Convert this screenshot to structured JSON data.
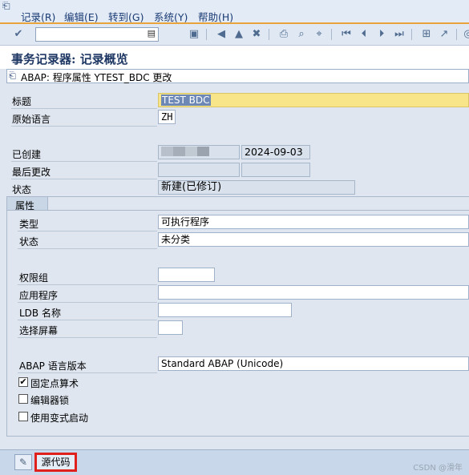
{
  "menubar": {
    "items": [
      "记录(R)",
      "编辑(E)",
      "转到(G)",
      "系统(Y)",
      "帮助(H)"
    ]
  },
  "toolbar": {
    "command_value": "",
    "icons": [
      "check-icon",
      "save-icon",
      "back-icon",
      "exit-icon",
      "cancel-icon",
      "print-icon",
      "find-icon",
      "find-next-icon",
      "first-page-icon",
      "prev-page-icon",
      "next-page-icon",
      "last-page-icon",
      "layout-icon",
      "help-icon"
    ]
  },
  "page": {
    "title": "事务记录器: 记录概览",
    "subheading": "ABAP: 程序属性 YTEST_BDC 更改"
  },
  "form": {
    "title_label": "标题",
    "title_value": "TEST BDC",
    "lang_label": "原始语言",
    "lang_value": "ZH",
    "created_label": "已创建",
    "created_date": "2024-09-03",
    "changed_label": "最后更改",
    "status_label": "状态",
    "status_value": "新建(已修订)"
  },
  "attributes": {
    "tab_label": "属性",
    "type_label": "类型",
    "type_value": "可执行程序",
    "status_label": "状态",
    "status_value": "未分类",
    "auth_group_label": "权限组",
    "application_label": "应用程序",
    "ldb_label": "LDB 名称",
    "screen_label": "选择屏幕",
    "abap_version_label": "ABAP 语言版本",
    "abap_version_value": "Standard ABAP (Unicode)",
    "fixed_point_label": "固定点算术",
    "fixed_point_checked": true,
    "editor_lock_label": "编辑器锁",
    "editor_lock_checked": false,
    "variant_start_label": "使用变式启动",
    "variant_start_checked": false
  },
  "footer": {
    "source_code_button": "源代码",
    "watermark": "CSDN @滑年"
  },
  "colors": {
    "accent_border": "#e0201b",
    "menu_underline": "#e8a33a",
    "title_field": "#f9e589"
  }
}
